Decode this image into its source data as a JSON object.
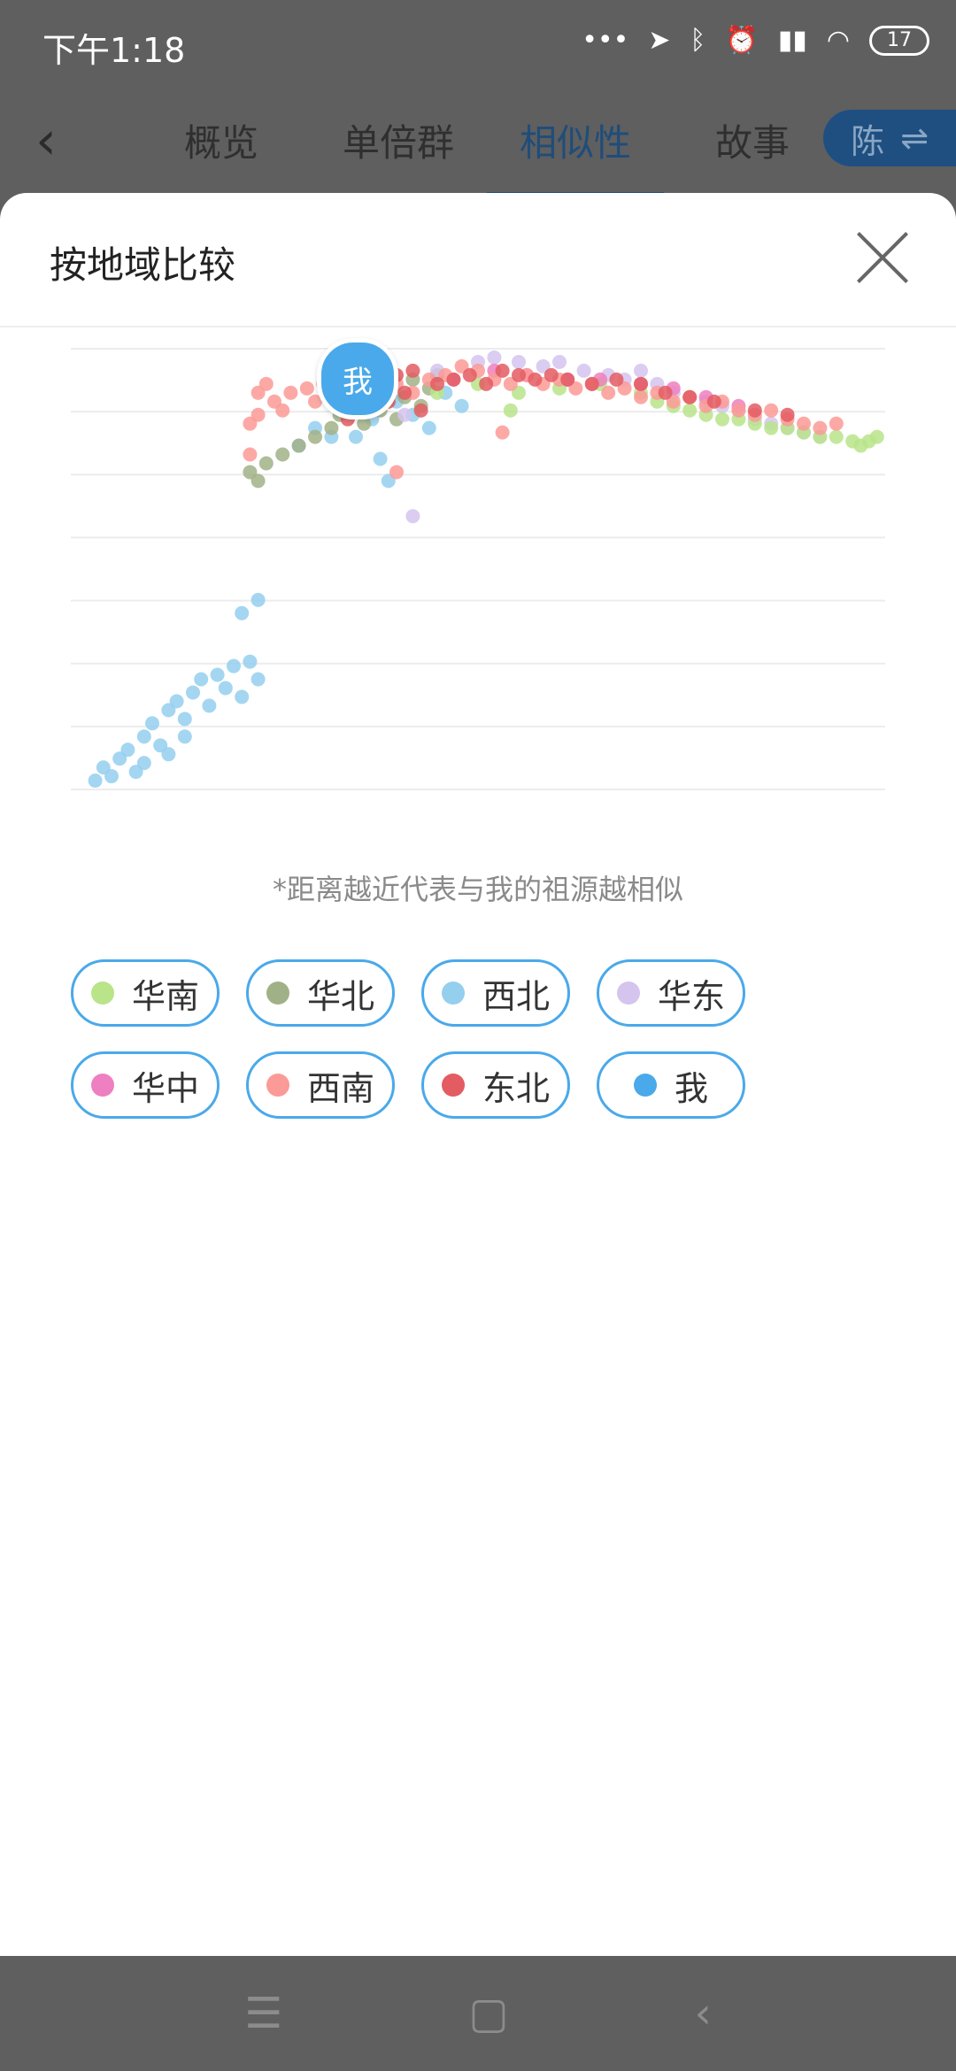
{
  "status_bar": {
    "time": "下午1:18",
    "battery": "17"
  },
  "nav": {
    "tabs": [
      "概览",
      "单倍群",
      "相似性",
      "故事"
    ],
    "active_tab": 2,
    "switch_label": "陈",
    "switch_icon": "swap-arrows-icon"
  },
  "sheet": {
    "title": "按地域比较",
    "me_label": "我",
    "note": "*距离越近代表与我的祖源越相似"
  },
  "legend": [
    {
      "label": "华南",
      "color": "#b9e48a"
    },
    {
      "label": "华北",
      "color": "#a1b187"
    },
    {
      "label": "西北",
      "color": "#94cfee"
    },
    {
      "label": "华东",
      "color": "#d5c4ee"
    },
    {
      "label": "华中",
      "color": "#ee7fc0"
    },
    {
      "label": "西南",
      "color": "#fb9a97"
    },
    {
      "label": "东北",
      "color": "#e35c62"
    },
    {
      "label": "我",
      "color": "#4aa9ea"
    }
  ],
  "chart_data": {
    "type": "scatter",
    "xlim": [
      0,
      100
    ],
    "ylim": [
      0,
      100
    ],
    "grid": true,
    "series": [
      {
        "name": "西北",
        "color": "#94cfee",
        "points": [
          [
            3,
            2
          ],
          [
            4,
            5
          ],
          [
            5,
            3
          ],
          [
            6,
            7
          ],
          [
            7,
            9
          ],
          [
            8,
            4
          ],
          [
            9,
            12
          ],
          [
            10,
            15
          ],
          [
            11,
            10
          ],
          [
            12,
            18
          ],
          [
            13,
            20
          ],
          [
            14,
            16
          ],
          [
            15,
            22
          ],
          [
            16,
            25
          ],
          [
            17,
            19
          ],
          [
            18,
            26
          ],
          [
            19,
            23
          ],
          [
            20,
            28
          ],
          [
            21,
            21
          ],
          [
            22,
            29
          ],
          [
            23,
            25
          ],
          [
            14,
            12
          ],
          [
            9,
            6
          ],
          [
            12,
            8
          ],
          [
            21,
            40
          ],
          [
            23,
            43
          ],
          [
            28,
            78
          ],
          [
            30,
            82
          ],
          [
            32,
            80
          ],
          [
            33,
            86
          ],
          [
            35,
            80
          ],
          [
            37,
            84
          ],
          [
            38,
            75
          ],
          [
            39,
            70
          ],
          [
            40,
            88
          ],
          [
            42,
            85
          ],
          [
            44,
            82
          ],
          [
            46,
            90
          ],
          [
            48,
            87
          ]
        ]
      },
      {
        "name": "华北",
        "color": "#a1b187",
        "points": [
          [
            22,
            72
          ],
          [
            23,
            70
          ],
          [
            24,
            74
          ],
          [
            26,
            76
          ],
          [
            28,
            78
          ],
          [
            30,
            80
          ],
          [
            32,
            82
          ],
          [
            33,
            85
          ],
          [
            34,
            88
          ],
          [
            36,
            83
          ],
          [
            37,
            90
          ],
          [
            38,
            86
          ],
          [
            39,
            92
          ],
          [
            40,
            84
          ],
          [
            41,
            89
          ],
          [
            42,
            93
          ],
          [
            43,
            87
          ],
          [
            44,
            91
          ],
          [
            45,
            94
          ]
        ]
      },
      {
        "name": "华东",
        "color": "#d5c4ee",
        "points": [
          [
            41,
            85
          ],
          [
            45,
            95
          ],
          [
            50,
            97
          ],
          [
            52,
            98
          ],
          [
            55,
            97
          ],
          [
            58,
            96
          ],
          [
            60,
            97
          ],
          [
            63,
            95
          ],
          [
            66,
            94
          ],
          [
            68,
            93
          ],
          [
            70,
            95
          ],
          [
            72,
            92
          ],
          [
            74,
            90
          ],
          [
            76,
            89
          ],
          [
            78,
            88
          ],
          [
            80,
            87
          ],
          [
            82,
            86
          ],
          [
            84,
            84
          ],
          [
            86,
            83
          ],
          [
            88,
            82
          ],
          [
            90,
            81
          ],
          [
            92,
            80
          ],
          [
            42,
            62
          ]
        ]
      },
      {
        "name": "华南",
        "color": "#b9e48a",
        "points": [
          [
            45,
            90
          ],
          [
            50,
            92
          ],
          [
            55,
            90
          ],
          [
            60,
            91
          ],
          [
            65,
            92
          ],
          [
            70,
            90
          ],
          [
            72,
            88
          ],
          [
            74,
            87
          ],
          [
            76,
            86
          ],
          [
            78,
            85
          ],
          [
            80,
            84
          ],
          [
            82,
            84
          ],
          [
            84,
            83
          ],
          [
            86,
            82
          ],
          [
            88,
            82
          ],
          [
            90,
            81
          ],
          [
            92,
            80
          ],
          [
            94,
            80
          ],
          [
            96,
            79
          ],
          [
            97,
            78
          ],
          [
            98,
            79
          ],
          [
            99,
            80
          ],
          [
            54,
            86
          ]
        ]
      },
      {
        "name": "华中",
        "color": "#ee7fc0",
        "points": [
          [
            47,
            93
          ],
          [
            52,
            95
          ],
          [
            56,
            94
          ],
          [
            61,
            93
          ],
          [
            65,
            93
          ],
          [
            70,
            92
          ],
          [
            74,
            91
          ],
          [
            78,
            89
          ],
          [
            82,
            87
          ]
        ]
      },
      {
        "name": "西南",
        "color": "#fb9a97",
        "points": [
          [
            22,
            76
          ],
          [
            22,
            83
          ],
          [
            23,
            85
          ],
          [
            23,
            90
          ],
          [
            24,
            92
          ],
          [
            25,
            88
          ],
          [
            26,
            86
          ],
          [
            27,
            90
          ],
          [
            29,
            91
          ],
          [
            30,
            88
          ],
          [
            31,
            92
          ],
          [
            33,
            91
          ],
          [
            35,
            89
          ],
          [
            36,
            86
          ],
          [
            38,
            88
          ],
          [
            40,
            92
          ],
          [
            42,
            90
          ],
          [
            44,
            93
          ],
          [
            46,
            94
          ],
          [
            48,
            96
          ],
          [
            50,
            95
          ],
          [
            52,
            93
          ],
          [
            54,
            92
          ],
          [
            56,
            94
          ],
          [
            58,
            92
          ],
          [
            60,
            93
          ],
          [
            62,
            91
          ],
          [
            64,
            92
          ],
          [
            66,
            90
          ],
          [
            68,
            91
          ],
          [
            70,
            89
          ],
          [
            72,
            90
          ],
          [
            74,
            88
          ],
          [
            76,
            89
          ],
          [
            78,
            87
          ],
          [
            80,
            88
          ],
          [
            82,
            86
          ],
          [
            84,
            85
          ],
          [
            86,
            86
          ],
          [
            88,
            84
          ],
          [
            90,
            83
          ],
          [
            92,
            82
          ],
          [
            94,
            83
          ],
          [
            40,
            72
          ],
          [
            53,
            81
          ]
        ]
      },
      {
        "name": "东北",
        "color": "#e35c62",
        "points": [
          [
            34,
            84
          ],
          [
            35,
            87
          ],
          [
            36,
            89
          ],
          [
            37,
            86
          ],
          [
            38,
            91
          ],
          [
            39,
            88
          ],
          [
            40,
            94
          ],
          [
            41,
            90
          ],
          [
            42,
            95
          ],
          [
            43,
            86
          ],
          [
            45,
            92
          ],
          [
            47,
            93
          ],
          [
            49,
            94
          ],
          [
            51,
            92
          ],
          [
            53,
            95
          ],
          [
            55,
            94
          ],
          [
            57,
            93
          ],
          [
            59,
            94
          ],
          [
            61,
            93
          ],
          [
            64,
            92
          ],
          [
            67,
            93
          ],
          [
            70,
            92
          ],
          [
            73,
            90
          ],
          [
            76,
            89
          ],
          [
            79,
            88
          ],
          [
            84,
            86
          ],
          [
            88,
            85
          ]
        ]
      },
      {
        "name": "我",
        "color": "#4aa9ea",
        "points": [
          [
            43,
            95
          ]
        ]
      }
    ]
  },
  "system_nav": [
    "menu-icon",
    "home-icon",
    "back-icon"
  ]
}
